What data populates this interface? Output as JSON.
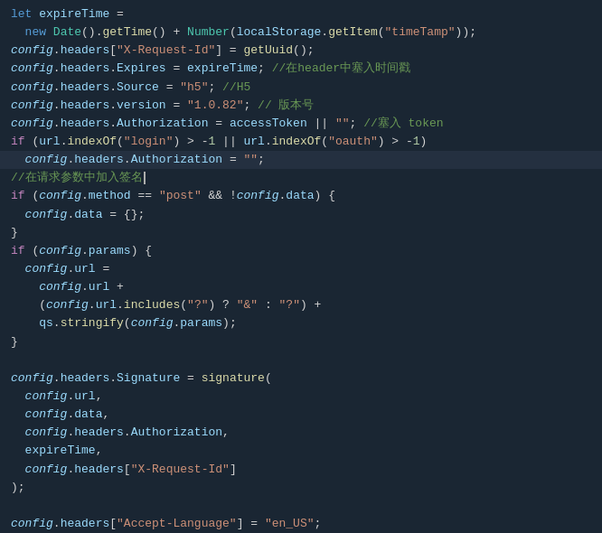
{
  "editor": {
    "background": "#1a2633",
    "lines": [
      {
        "id": 1,
        "content": "let expireTime ="
      },
      {
        "id": 2,
        "content": "  new Date().getTime() + Number(localStorage.getItem(\"timeTamp\"));"
      },
      {
        "id": 3,
        "content": "config.headers[\"X-Request-Id\"] = getUuid();"
      },
      {
        "id": 4,
        "content": "config.headers.Expires = expireTime; //在header中塞入时间戳"
      },
      {
        "id": 5,
        "content": "config.headers.Source = \"h5\"; //H5"
      },
      {
        "id": 6,
        "content": "config.headers.version = \"1.0.82\"; // 版本号"
      },
      {
        "id": 7,
        "content": "config.headers.Authorization = accessToken || \"\"; //塞入 token"
      },
      {
        "id": 8,
        "content": "if (url.indexOf(\"login\") > -1 || url.indexOf(\"oauth\") > -1)"
      },
      {
        "id": 9,
        "content": "  config.headers.Authorization = \"\";"
      },
      {
        "id": 10,
        "content": "//在请求参数中加入签名"
      },
      {
        "id": 11,
        "content": "if (config.method == \"post\" && !config.data) {"
      },
      {
        "id": 12,
        "content": "  config.data = {};"
      },
      {
        "id": 13,
        "content": "}"
      },
      {
        "id": 14,
        "content": "if (config.params) {"
      },
      {
        "id": 15,
        "content": "  config.url ="
      },
      {
        "id": 16,
        "content": "    config.url +"
      },
      {
        "id": 17,
        "content": "    (config.url.includes(\"?\") ? \"&\" : \"?\") +"
      },
      {
        "id": 18,
        "content": "    qs.stringify(config.params);"
      },
      {
        "id": 19,
        "content": "}"
      },
      {
        "id": 20,
        "content": ""
      },
      {
        "id": 21,
        "content": "config.headers.Signature = signature("
      },
      {
        "id": 22,
        "content": "  config.url,"
      },
      {
        "id": 23,
        "content": "  config.data,"
      },
      {
        "id": 24,
        "content": "  config.headers.Authorization,"
      },
      {
        "id": 25,
        "content": "  expireTime,"
      },
      {
        "id": 26,
        "content": "  config.headers[\"X-Request-Id\"]"
      },
      {
        "id": 27,
        "content": ");"
      },
      {
        "id": 28,
        "content": ""
      },
      {
        "id": 29,
        "content": "config.headers[\"Accept-Language\"] = \"en_US\";"
      }
    ]
  }
}
